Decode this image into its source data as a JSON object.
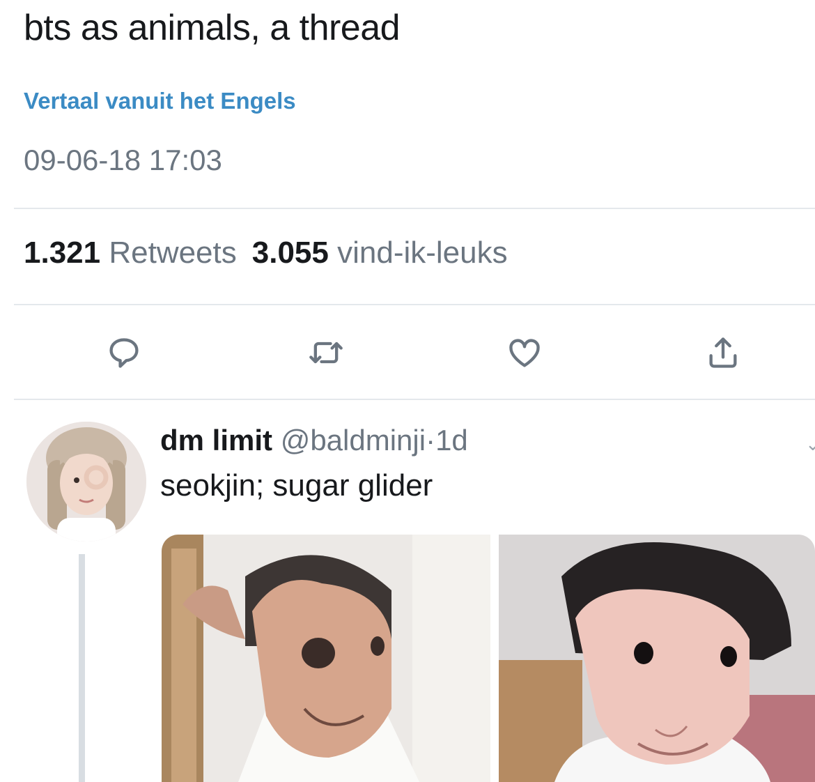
{
  "tweet": {
    "text": "bts as animals, a thread",
    "translate_label": "Vertaal vanuit het Engels",
    "timestamp": "09-06-18 17:03"
  },
  "stats": {
    "retweets_count": "1.321",
    "retweets_label": "Retweets",
    "likes_count": "3.055",
    "likes_label": "vind-ik-leuks"
  },
  "actions": {
    "icons": [
      "reply-icon",
      "retweet-icon",
      "like-icon",
      "share-icon"
    ]
  },
  "reply": {
    "display_name": "dm limit",
    "handle": "@baldminji",
    "separator": "·",
    "age": "1d",
    "text": "seokjin; sugar glider"
  },
  "colors": {
    "link": "#3b8bc4",
    "muted": "#6b7580",
    "text": "#17191c",
    "divider": "#e4e8ec"
  }
}
